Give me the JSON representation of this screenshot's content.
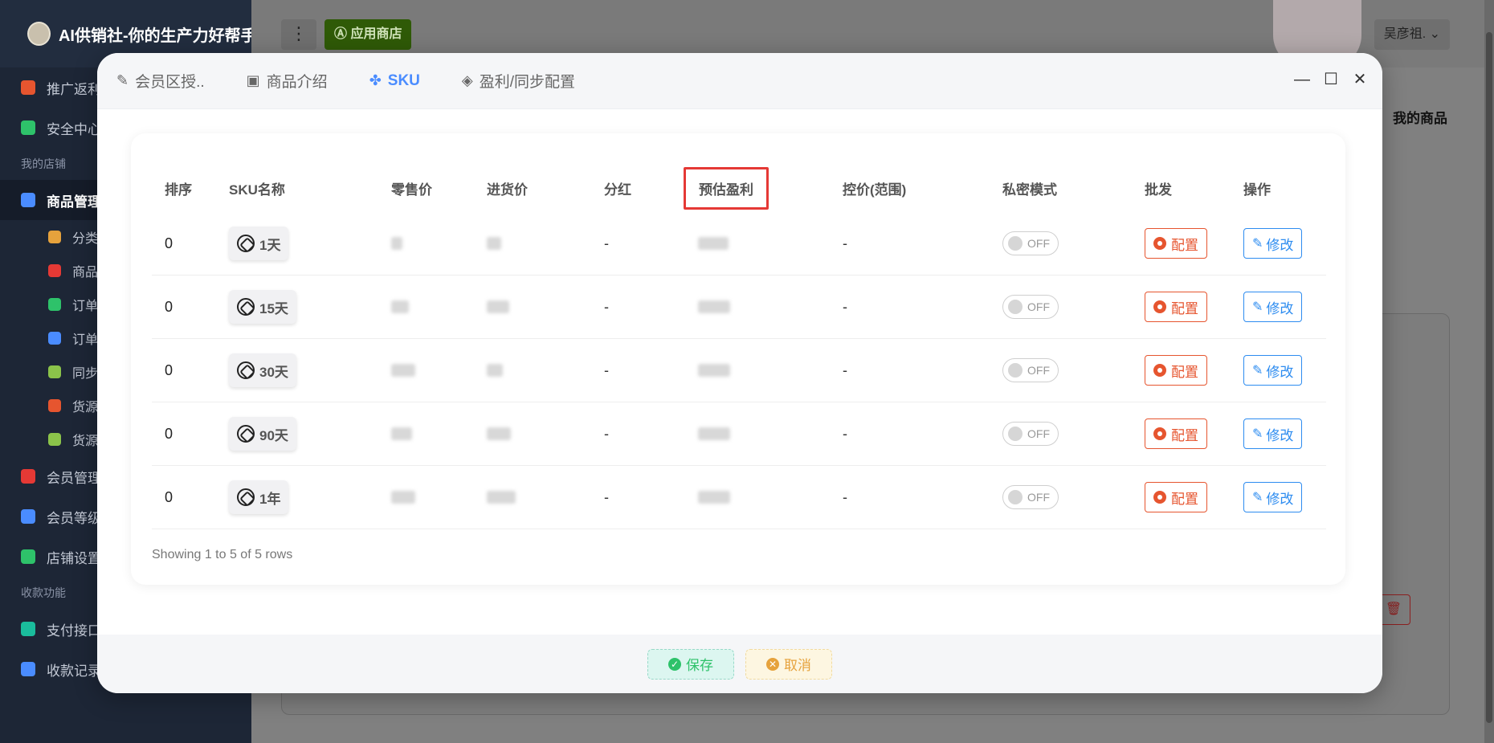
{
  "app": {
    "brand_title": "AI供销社-你的生产力好帮手"
  },
  "sidebar": {
    "items": [
      {
        "label": "推广返利",
        "icon": "paper-plane-icon",
        "color": "#e6552f"
      },
      {
        "label": "安全中心",
        "icon": "shield-icon",
        "color": "#2ec26a"
      }
    ],
    "group_store": "我的店铺",
    "store_items": [
      {
        "label": "商品管理",
        "icon": "box-icon",
        "color": "#4a8cff"
      }
    ],
    "sub_items": [
      {
        "label": "分类",
        "icon": "tag-icon",
        "color": "#e6a23c"
      },
      {
        "label": "商品",
        "icon": "bag-icon",
        "color": "#e53935"
      },
      {
        "label": "订单",
        "icon": "list-icon",
        "color": "#2ec26a"
      },
      {
        "label": "订单",
        "icon": "pie-icon",
        "color": "#4a8cff"
      },
      {
        "label": "同步",
        "icon": "ticket-icon",
        "color": "#8bc34a"
      },
      {
        "label": "货源",
        "icon": "store-icon",
        "color": "#e6552f"
      },
      {
        "label": "货源",
        "icon": "edit-icon",
        "color": "#8bc34a"
      }
    ],
    "more_items": [
      {
        "label": "会员管理",
        "icon": "user-icon",
        "color": "#e53935"
      },
      {
        "label": "会员等级",
        "icon": "heart-icon",
        "color": "#4a8cff"
      },
      {
        "label": "店铺设置",
        "icon": "hexagon-icon",
        "color": "#2ec26a"
      }
    ],
    "group_pay": "收款功能",
    "pay_items": [
      {
        "label": "支付接口",
        "icon": "yen-icon",
        "color": "#1abc9c"
      },
      {
        "label": "收款记录",
        "icon": "receipt-icon",
        "color": "#4a8cff"
      }
    ]
  },
  "topbar": {
    "more": "⋮",
    "store_button": "应用商店",
    "user": "吴彦祖."
  },
  "background": {
    "page_title": "我的商品"
  },
  "modal": {
    "tabs": [
      {
        "label": "会员区授..",
        "icon": "edit-icon"
      },
      {
        "label": "商品介绍",
        "icon": "save-icon"
      },
      {
        "label": "SKU",
        "icon": "clover-icon",
        "active": true
      },
      {
        "label": "盈利/同步配置",
        "icon": "ticket-icon"
      }
    ],
    "controls": {
      "minimize": "—",
      "maximize": "☐",
      "close": "✕"
    },
    "table": {
      "headers": [
        "排序",
        "SKU名称",
        "零售价",
        "进货价",
        "分红",
        "预估盈利",
        "控价(范围)",
        "私密模式",
        "批发",
        "操作"
      ],
      "rows": [
        {
          "sort": "0",
          "name": "1天",
          "dividend": "-",
          "control": "-",
          "private": "OFF",
          "cfg": "配置",
          "edit": "修改"
        },
        {
          "sort": "0",
          "name": "15天",
          "dividend": "-",
          "control": "-",
          "private": "OFF",
          "cfg": "配置",
          "edit": "修改"
        },
        {
          "sort": "0",
          "name": "30天",
          "dividend": "-",
          "control": "-",
          "private": "OFF",
          "cfg": "配置",
          "edit": "修改"
        },
        {
          "sort": "0",
          "name": "90天",
          "dividend": "-",
          "control": "-",
          "private": "OFF",
          "cfg": "配置",
          "edit": "修改"
        },
        {
          "sort": "0",
          "name": "1年",
          "dividend": "-",
          "control": "-",
          "private": "OFF",
          "cfg": "配置",
          "edit": "修改"
        }
      ],
      "footer": "Showing 1 to 5 of 5 rows"
    },
    "buttons": {
      "save": "保存",
      "cancel": "取消"
    }
  }
}
